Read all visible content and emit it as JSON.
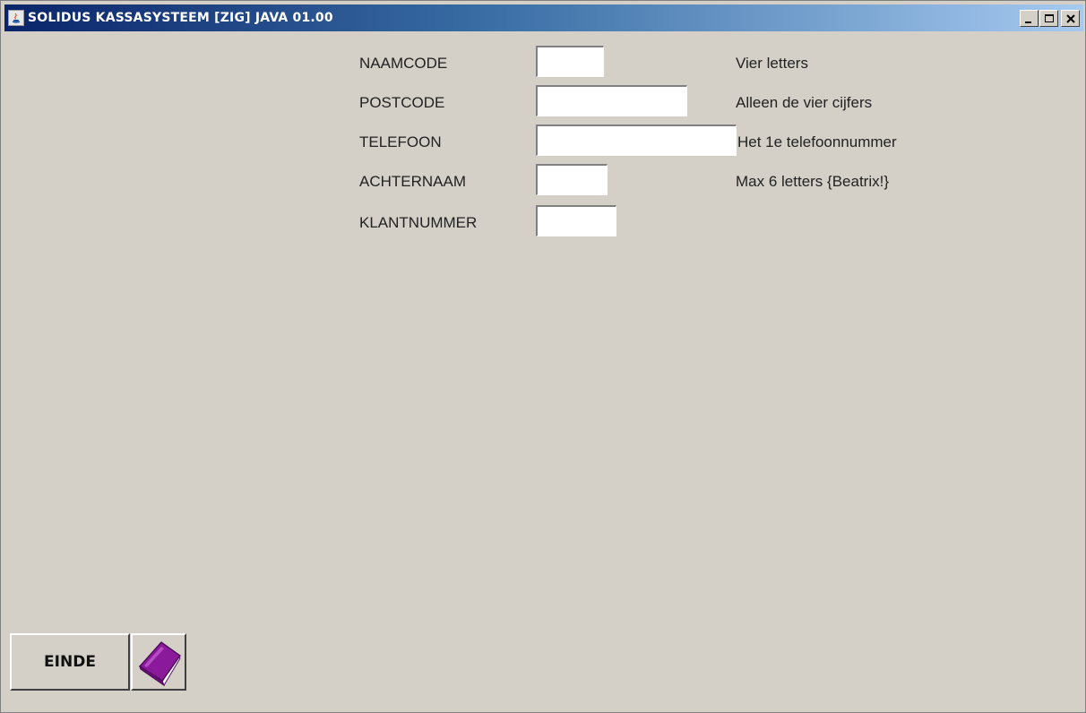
{
  "window": {
    "title": "SOLIDUS KASSASYSTEEM [ZIG] JAVA 01.00"
  },
  "form": {
    "fields": [
      {
        "label": "NAAMCODE",
        "value": "",
        "hint": "Vier letters"
      },
      {
        "label": "POSTCODE",
        "value": "",
        "hint": "Alleen de vier cijfers"
      },
      {
        "label": "TELEFOON",
        "value": "",
        "hint": "Het 1e telefoonnummer"
      },
      {
        "label": "ACHTERNAAM",
        "value": "",
        "hint": "Max 6 letters {Beatrix!}"
      },
      {
        "label": "KLANTNUMMER",
        "value": "",
        "hint": ""
      }
    ]
  },
  "footer": {
    "exit_label": "EINDE",
    "book_icon": "book-icon"
  },
  "colors": {
    "window_bg": "#d4d0c8",
    "title_gradient_start": "#0a246a",
    "title_gradient_end": "#a6caf0",
    "book_purple": "#8b1a9b"
  }
}
